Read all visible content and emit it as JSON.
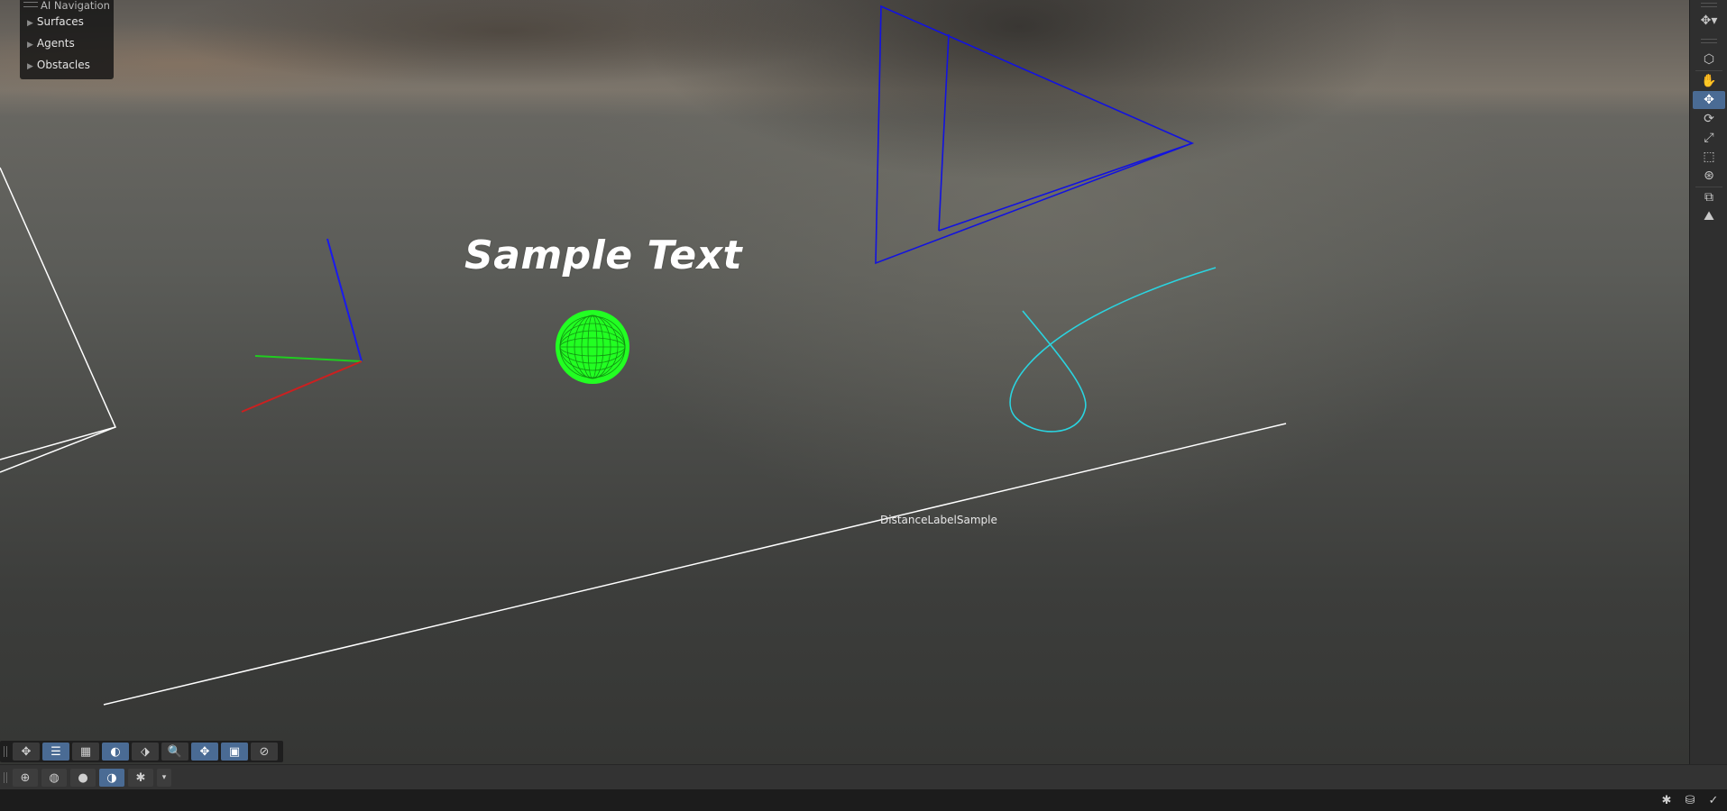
{
  "viewport": {
    "sample_text": "Sample Text",
    "distance_label": "DistanceLabelSample"
  },
  "nav_panel": {
    "title": "AI Navigation",
    "items": [
      {
        "label": "Surfaces",
        "expanded": false
      },
      {
        "label": "Agents",
        "expanded": false
      },
      {
        "label": "Obstacles",
        "expanded": false
      }
    ]
  },
  "right_strip": {
    "buttons": [
      {
        "icon": "move-pivot-icon",
        "glyph": "✥▾",
        "active": false
      },
      {
        "icon": "cube-icon",
        "glyph": "⬡",
        "active": false
      },
      {
        "icon": "hand-pan-icon",
        "glyph": "✋",
        "active": false
      },
      {
        "icon": "move-icon",
        "glyph": "✥",
        "active": true
      },
      {
        "icon": "rotate-icon",
        "glyph": "⟳",
        "active": false
      },
      {
        "icon": "scale-icon",
        "glyph": "⤢",
        "active": false
      },
      {
        "icon": "rect-transform-icon",
        "glyph": "⬚",
        "active": false
      },
      {
        "icon": "custom-tool-icon",
        "glyph": "⊛",
        "active": false
      },
      {
        "icon": "layers-icon",
        "glyph": "⧉",
        "active": false
      },
      {
        "icon": "terrain-tool-icon",
        "glyph": "⛰",
        "active": false
      }
    ]
  },
  "bottom_toolbar": {
    "buttons": [
      {
        "icon": "move-gizmo-icon",
        "glyph": "✥",
        "active": false
      },
      {
        "icon": "settings-sliders-icon",
        "glyph": "☰",
        "active": true
      },
      {
        "icon": "grid-icon",
        "glyph": "▦",
        "active": false
      },
      {
        "icon": "lighting-icon",
        "glyph": "◐",
        "active": true
      },
      {
        "icon": "snap-icon",
        "glyph": "⬗",
        "active": false
      },
      {
        "icon": "search-icon",
        "glyph": "🔍",
        "active": false
      },
      {
        "icon": "orientation-icon",
        "glyph": "✥",
        "active": true
      },
      {
        "icon": "camera-icon",
        "glyph": "▣",
        "active": true
      },
      {
        "icon": "compass-icon",
        "glyph": "⊘",
        "active": false
      }
    ]
  },
  "status_toolbar": {
    "buttons": [
      {
        "icon": "wireframe-globe-icon",
        "glyph": "⊕",
        "active": false
      },
      {
        "icon": "shaded-wireframe-icon",
        "glyph": "◍",
        "active": false
      },
      {
        "icon": "shaded-sphere-icon",
        "glyph": "●",
        "active": false
      },
      {
        "icon": "render-mode-icon",
        "glyph": "◑",
        "active": true
      },
      {
        "icon": "debug-bug-icon",
        "glyph": "✱",
        "active": false
      },
      {
        "icon": "dropdown-icon",
        "glyph": "▾",
        "active": false
      }
    ]
  },
  "status_icons": [
    {
      "icon": "bug-icon",
      "glyph": "✱"
    },
    {
      "icon": "database-icon",
      "glyph": "⛁"
    },
    {
      "icon": "check-circle-icon",
      "glyph": "✓"
    }
  ],
  "colors": {
    "gizmo_x": "#cc2020",
    "gizmo_y": "#20cc20",
    "gizmo_z": "#1a1aee",
    "frustum": "#1212e0",
    "curve": "#2ad4e0",
    "sphere": "#22ff22",
    "line": "#ffffff",
    "accent": "#4a6b94"
  }
}
